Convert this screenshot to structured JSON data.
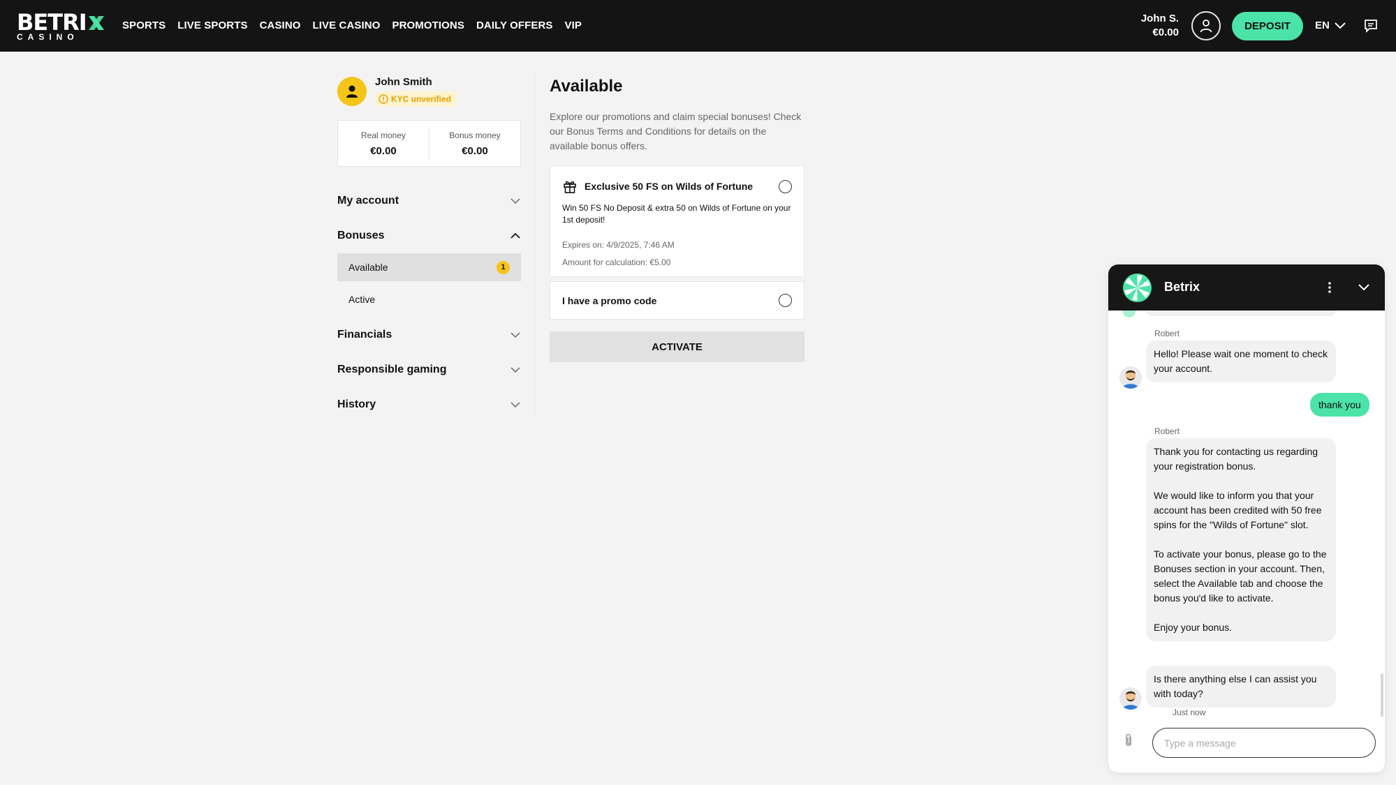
{
  "header": {
    "logo_word": "BETRI",
    "logo_sub": "CASINO",
    "nav": [
      "SPORTS",
      "LIVE SPORTS",
      "CASINO",
      "LIVE CASINO",
      "PROMOTIONS",
      "DAILY OFFERS",
      "VIP"
    ],
    "user_short": "John S.",
    "user_balance": "€0.00",
    "deposit_label": "DEPOSIT",
    "language": "EN"
  },
  "sidebar": {
    "name": "John Smith",
    "kyc_status": "KYC unverified",
    "real_money_label": "Real money",
    "real_money_value": "€0.00",
    "bonus_money_label": "Bonus money",
    "bonus_money_value": "€0.00",
    "sections": {
      "my_account": "My account",
      "bonuses": "Bonuses",
      "financials": "Financials",
      "responsible_gaming": "Responsible gaming",
      "history": "History"
    },
    "bonus_items": [
      {
        "label": "Available",
        "count": "1"
      },
      {
        "label": "Active"
      }
    ]
  },
  "main": {
    "title": "Available",
    "intro": "Explore our promotions and claim special bonuses! Check our Bonus Terms and Conditions for details on the available bonus offers.",
    "bonus": {
      "title": "Exclusive 50 FS on Wilds of Fortune",
      "description": "Win 50 FS No Deposit & extra 50 on Wilds of Fortune on your 1st deposit!",
      "expires": "Expires on: 4/9/2025, 7:46 AM",
      "amount": "Amount for calculation: €5.00"
    },
    "promo_label": "I have a promo code",
    "activate_label": "ACTIVATE"
  },
  "chat": {
    "title": "Betrix",
    "messages": [
      {
        "sender": "Robert",
        "text": "Hello! Please wait one moment to check your account."
      },
      {
        "from": "user",
        "text": "thank you"
      },
      {
        "sender": "Robert",
        "paragraphs": [
          "Thank you for contacting us regarding your registration bonus.",
          "We would like to inform you that your account has been credited with 50 free spins for the \"Wilds of Fortune\" slot.",
          "To activate your bonus, please go to the Bonuses section in your account. Then, select the Available tab and choose the bonus you'd like to activate.",
          "Enjoy your bonus."
        ]
      },
      {
        "text": "Is there anything else I can assist you with today?",
        "time": "Just now"
      }
    ],
    "input_placeholder": "Type a message"
  },
  "colors": {
    "accent": "#4be3a7",
    "header_bg": "#141414",
    "badge_yellow": "#f5c518"
  },
  "icons": [
    "logo-x-icon",
    "user-icon",
    "chevron-down-icon",
    "chat-bubble-icon",
    "warning-icon",
    "chevron-up-icon",
    "gift-icon",
    "more-vertical-icon",
    "paperclip-icon"
  ]
}
